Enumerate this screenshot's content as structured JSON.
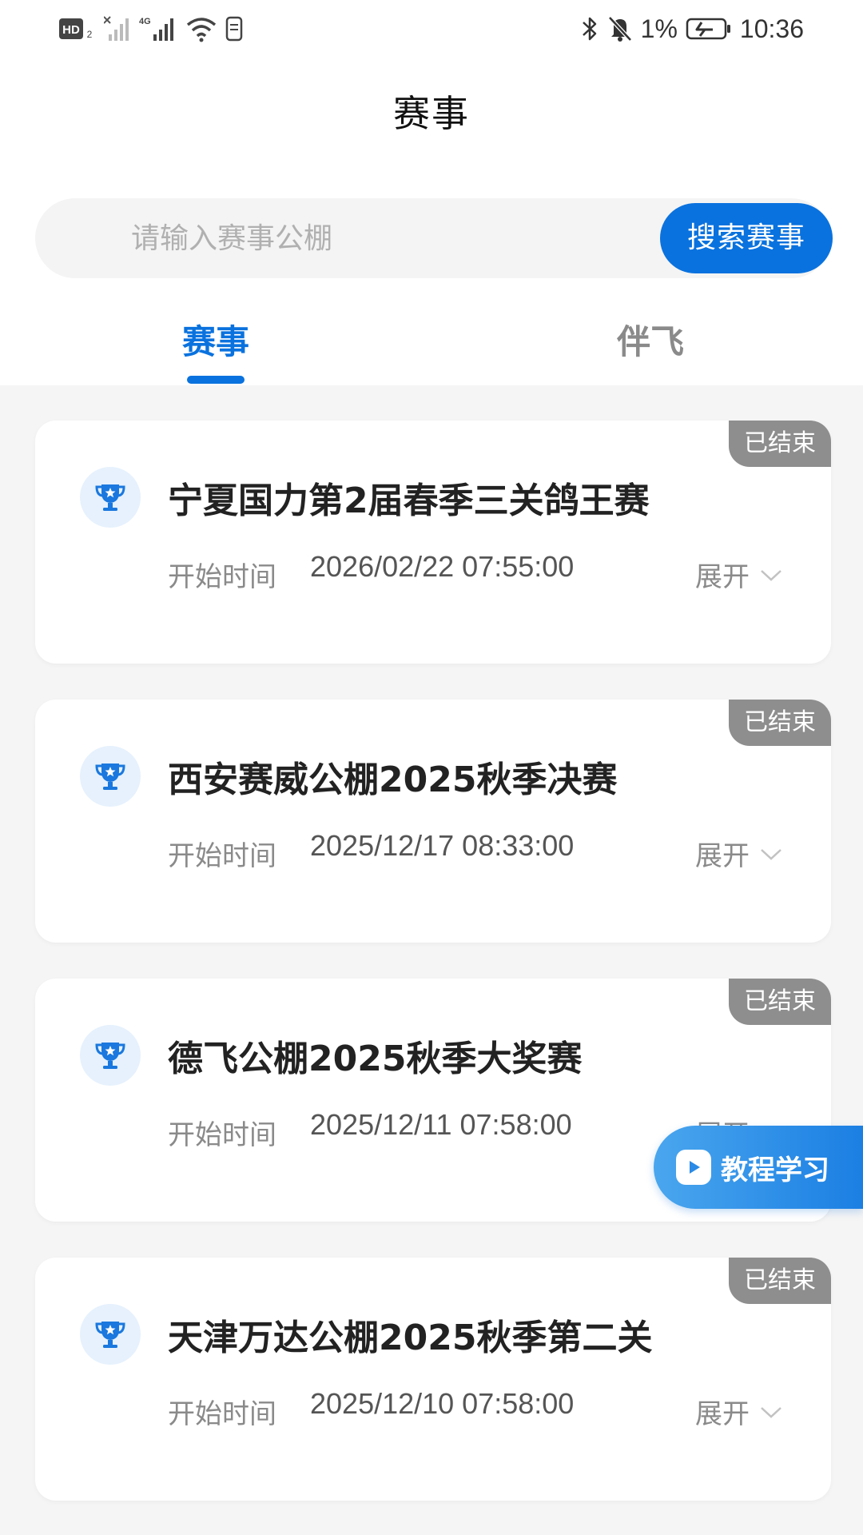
{
  "status_bar": {
    "hd_label": "HD",
    "network_label": "4G",
    "battery_percent": "1%",
    "time": "10:36"
  },
  "header": {
    "title": "赛事"
  },
  "search": {
    "placeholder": "请输入赛事公棚",
    "button_label": "搜索赛事"
  },
  "tabs": [
    {
      "label": "赛事",
      "active": true
    },
    {
      "label": "伴飞",
      "active": false
    }
  ],
  "races": [
    {
      "status": "已结束",
      "title": "宁夏国力第2届春季三关鸽王赛",
      "start_label": "开始时间",
      "start_time": "2026/02/22 07:55:00",
      "expand_label": "展开"
    },
    {
      "status": "已结束",
      "title": "西安赛威公棚2025秋季决赛",
      "start_label": "开始时间",
      "start_time": "2025/12/17 08:33:00",
      "expand_label": "展开"
    },
    {
      "status": "已结束",
      "title": "德飞公棚2025秋季大奖赛",
      "start_label": "开始时间",
      "start_time": "2025/12/11 07:58:00",
      "expand_label": "展开"
    },
    {
      "status": "已结束",
      "title": "天津万达公棚2025秋季第二关",
      "start_label": "开始时间",
      "start_time": "2025/12/10 07:58:00",
      "expand_label": "展开"
    }
  ],
  "floating": {
    "tutorial_label": "教程学习"
  },
  "colors": {
    "accent": "#0a72de",
    "badge": "#8e8e8e",
    "background": "#f5f5f5"
  }
}
